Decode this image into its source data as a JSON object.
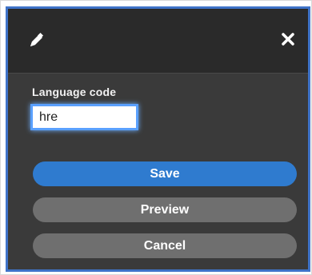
{
  "dialog": {
    "header": {
      "edit_icon": "pencil-icon",
      "close_icon": "close-icon"
    },
    "field": {
      "label": "Language code",
      "value": "hre"
    },
    "buttons": {
      "save": "Save",
      "preview": "Preview",
      "cancel": "Cancel"
    },
    "colors": {
      "accent": "#2f7bcf",
      "secondary": "#6f6f6f",
      "panel": "#3a3a3a",
      "header": "#2a2a2a",
      "frame": "#3f73c8"
    }
  }
}
